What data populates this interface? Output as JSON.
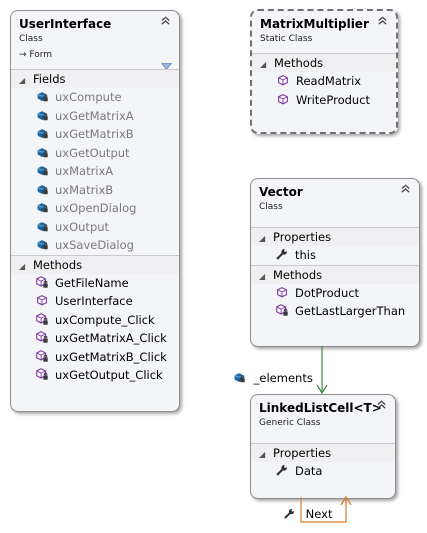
{
  "user_interface": {
    "title": "UserInterface",
    "kind": "Class",
    "base": "→ Form",
    "sections": [
      {
        "label": "Fields",
        "members": [
          "uxCompute",
          "uxGetMatrixA",
          "uxGetMatrixB",
          "uxGetOutput",
          "uxMatrixA",
          "uxMatrixB",
          "uxOpenDialog",
          "uxOutput",
          "uxSaveDialog"
        ]
      },
      {
        "label": "Methods",
        "members": [
          "GetFileName",
          "UserInterface",
          "uxCompute_Click",
          "uxGetMatrixA_Click",
          "uxGetMatrixB_Click",
          "uxGetOutput_Click"
        ]
      }
    ]
  },
  "matrix_multiplier": {
    "title": "MatrixMultiplier",
    "kind": "Static Class",
    "sections": [
      {
        "label": "Methods",
        "members": [
          "ReadMatrix",
          "WriteProduct"
        ]
      }
    ]
  },
  "vector": {
    "title": "Vector",
    "kind": "Class",
    "sections": [
      {
        "label": "Properties",
        "members": [
          "this"
        ]
      },
      {
        "label": "Methods",
        "members": [
          "DotProduct",
          "GetLastLargerThan"
        ]
      }
    ]
  },
  "linked_list_cell": {
    "title": "LinkedListCell<T>",
    "kind": "Generic Class",
    "sections": [
      {
        "label": "Properties",
        "members": [
          "Data"
        ]
      }
    ]
  },
  "associations": {
    "elements": "_elements",
    "next": "Next"
  },
  "colors": {
    "vector_link": "#3a8a45",
    "next_link": "#d97a2b",
    "private_field_text": "#7a7a7a",
    "method_icon": "#7e3fa7",
    "field_icon": "#1b6aa8"
  }
}
